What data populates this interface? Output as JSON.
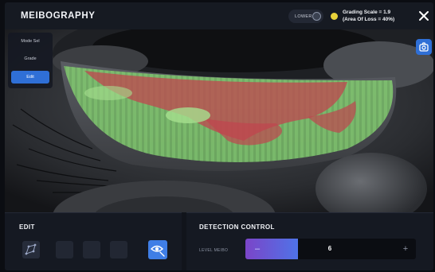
{
  "app": {
    "title": "MEIBOGRAPHY"
  },
  "header": {
    "eyelid_toggle_label": "LOWER",
    "grading_line1": "Grading Scale = 1.9",
    "grading_line2": "(Area Of Loss = 40%)",
    "grade_color": "#e8d23a",
    "close_icon": "close-icon"
  },
  "mode_menu": {
    "items": [
      "Mode Sel",
      "Grade",
      "Edit"
    ],
    "active": "Edit"
  },
  "snapshot_button": {
    "icon": "camera-icon"
  },
  "overlay_colors": {
    "gland_area": "#7cc86a",
    "loss_area": "#c0454f"
  },
  "edit_panel": {
    "title": "EDIT",
    "tools": [
      "polygon-icon",
      "tool-2",
      "tool-3",
      "tool-4",
      "eye-icon"
    ]
  },
  "detection": {
    "title": "DETECTION CONTROL",
    "level_label": "LEVEL MEIBO",
    "minus": "–",
    "value": "6",
    "plus": "+",
    "level_fraction": 0.31
  }
}
